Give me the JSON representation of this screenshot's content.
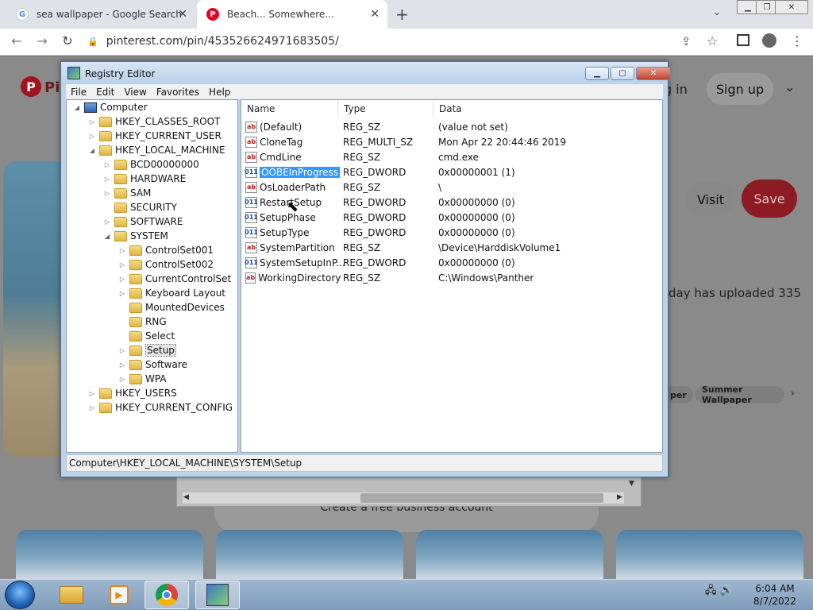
{
  "browser": {
    "tabs": [
      {
        "title": "sea wallpaper - Google Search",
        "favicon": "G"
      },
      {
        "title": "Beach... Somewhere...",
        "favicon": "P"
      }
    ],
    "url": "pinterest.com/pin/453526624971683505/"
  },
  "pinterest": {
    "login": "g in",
    "signup": "Sign up",
    "visit": "Visit",
    "save": "Save",
    "description": "day has uploaded 335",
    "chips": [
      "per",
      "Summer Wallpaper"
    ],
    "business": "Create a free business account"
  },
  "registry": {
    "title": "Registry Editor",
    "menu": [
      "File",
      "Edit",
      "View",
      "Favorites",
      "Help"
    ],
    "tree": [
      {
        "label": "Computer",
        "level": 0,
        "expander": "◢",
        "icon": "computer"
      },
      {
        "label": "HKEY_CLASSES_ROOT",
        "level": 1,
        "expander": "▷",
        "icon": "folder"
      },
      {
        "label": "HKEY_CURRENT_USER",
        "level": 1,
        "expander": "▷",
        "icon": "folder"
      },
      {
        "label": "HKEY_LOCAL_MACHINE",
        "level": 1,
        "expander": "◢",
        "icon": "folder"
      },
      {
        "label": "BCD00000000",
        "level": 2,
        "expander": "▷",
        "icon": "folder"
      },
      {
        "label": "HARDWARE",
        "level": 2,
        "expander": "▷",
        "icon": "folder"
      },
      {
        "label": "SAM",
        "level": 2,
        "expander": "▷",
        "icon": "folder"
      },
      {
        "label": "SECURITY",
        "level": 2,
        "expander": "",
        "icon": "folder"
      },
      {
        "label": "SOFTWARE",
        "level": 2,
        "expander": "▷",
        "icon": "folder"
      },
      {
        "label": "SYSTEM",
        "level": 2,
        "expander": "◢",
        "icon": "folder"
      },
      {
        "label": "ControlSet001",
        "level": 3,
        "expander": "▷",
        "icon": "folder"
      },
      {
        "label": "ControlSet002",
        "level": 3,
        "expander": "▷",
        "icon": "folder"
      },
      {
        "label": "CurrentControlSet",
        "level": 3,
        "expander": "▷",
        "icon": "folder"
      },
      {
        "label": "Keyboard Layout",
        "level": 3,
        "expander": "▷",
        "icon": "folder"
      },
      {
        "label": "MountedDevices",
        "level": 3,
        "expander": "",
        "icon": "folder"
      },
      {
        "label": "RNG",
        "level": 3,
        "expander": "",
        "icon": "folder"
      },
      {
        "label": "Select",
        "level": 3,
        "expander": "",
        "icon": "folder"
      },
      {
        "label": "Setup",
        "level": 3,
        "expander": "▷",
        "icon": "folder",
        "selected": true
      },
      {
        "label": "Software",
        "level": 3,
        "expander": "▷",
        "icon": "folder"
      },
      {
        "label": "WPA",
        "level": 3,
        "expander": "▷",
        "icon": "folder"
      },
      {
        "label": "HKEY_USERS",
        "level": 1,
        "expander": "▷",
        "icon": "folder"
      },
      {
        "label": "HKEY_CURRENT_CONFIG",
        "level": 1,
        "expander": "▷",
        "icon": "folder"
      }
    ],
    "columns": [
      "Name",
      "Type",
      "Data"
    ],
    "values": [
      {
        "name": "(Default)",
        "type": "REG_SZ",
        "data": "(value not set)",
        "icon": "ab"
      },
      {
        "name": "CloneTag",
        "type": "REG_MULTI_SZ",
        "data": "Mon Apr 22 20:44:46 2019",
        "icon": "ab"
      },
      {
        "name": "CmdLine",
        "type": "REG_SZ",
        "data": "cmd.exe",
        "icon": "ab"
      },
      {
        "name": "OOBEInProgress",
        "type": "REG_DWORD",
        "data": "0x00000001 (1)",
        "icon": "bin",
        "selected": true
      },
      {
        "name": "OsLoaderPath",
        "type": "REG_SZ",
        "data": "\\",
        "icon": "ab"
      },
      {
        "name": "RestartSetup",
        "type": "REG_DWORD",
        "data": "0x00000000 (0)",
        "icon": "bin"
      },
      {
        "name": "SetupPhase",
        "type": "REG_DWORD",
        "data": "0x00000000 (0)",
        "icon": "bin"
      },
      {
        "name": "SetupType",
        "type": "REG_DWORD",
        "data": "0x00000000 (0)",
        "icon": "bin"
      },
      {
        "name": "SystemPartition",
        "type": "REG_SZ",
        "data": "\\Device\\HarddiskVolume1",
        "icon": "ab"
      },
      {
        "name": "SystemSetupInP...",
        "type": "REG_DWORD",
        "data": "0x00000000 (0)",
        "icon": "bin"
      },
      {
        "name": "WorkingDirectory",
        "type": "REG_SZ",
        "data": "C:\\Windows\\Panther",
        "icon": "ab"
      }
    ],
    "status": "Computer\\HKEY_LOCAL_MACHINE\\SYSTEM\\Setup"
  },
  "taskbar": {
    "time": "6:04 AM",
    "date": "8/7/2022"
  },
  "colors": {
    "pinterest_red": "#e60023",
    "selection": "#3399ff"
  }
}
